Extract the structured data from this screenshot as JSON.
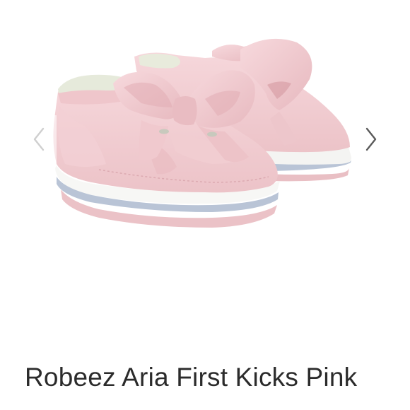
{
  "product": {
    "title": "Robeez Aria First Kicks Pink"
  },
  "gallery": {
    "prev_icon": "chevron-left-icon",
    "next_icon": "chevron-right-icon",
    "image_subject": "pink-baby-shoes-with-bows",
    "colors": {
      "shoe": "#f2cdd2",
      "sole_stripe": "#b9c4d6"
    }
  }
}
